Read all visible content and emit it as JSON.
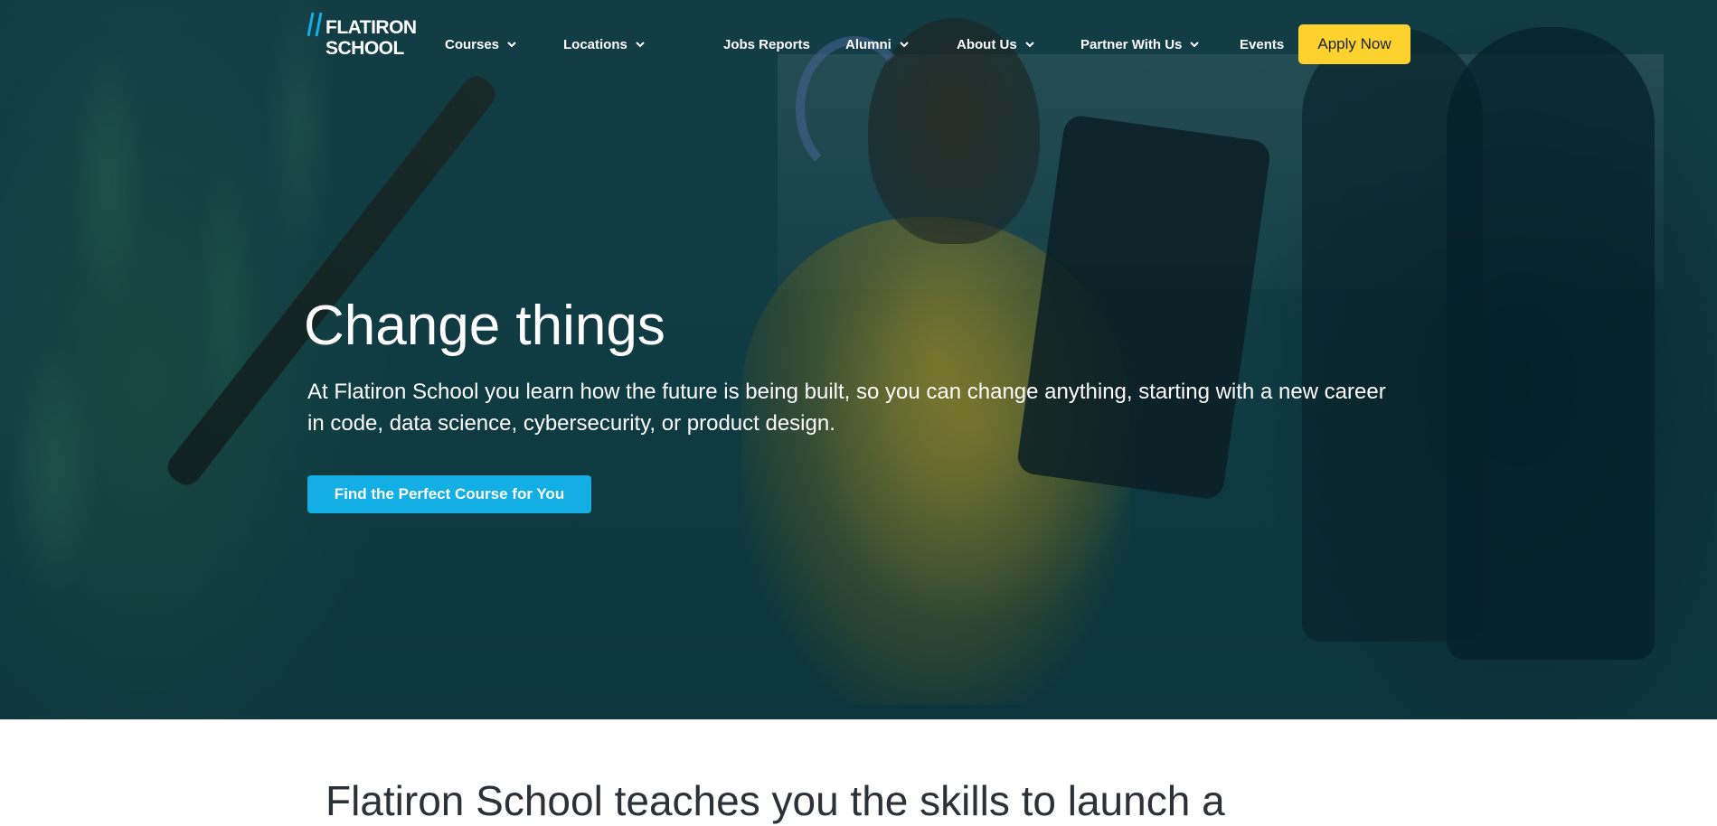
{
  "brand": {
    "logo_line1": "FLATIRON",
    "logo_line2": "SCHOOL",
    "accent_blue": "#12aee4",
    "accent_yellow": "#fdd22f"
  },
  "nav": {
    "items": [
      {
        "label": "Courses",
        "has_dropdown": true
      },
      {
        "label": "Locations",
        "has_dropdown": true
      },
      {
        "label": "Jobs Reports",
        "has_dropdown": false
      },
      {
        "label": "Alumni",
        "has_dropdown": true
      },
      {
        "label": "About Us",
        "has_dropdown": true
      },
      {
        "label": "Partner With Us",
        "has_dropdown": true
      },
      {
        "label": "Events",
        "has_dropdown": false
      }
    ],
    "apply_label": "Apply Now"
  },
  "hero": {
    "title": "Change things",
    "subtitle": "At Flatiron School you learn how the future is being built, so you can change anything, starting with a new career in code, data science, cybersecurity, or product design.",
    "cta_label": "Find the Perfect Course for You"
  },
  "intro": {
    "heading": "Flatiron School teaches you the skills to launch a"
  }
}
